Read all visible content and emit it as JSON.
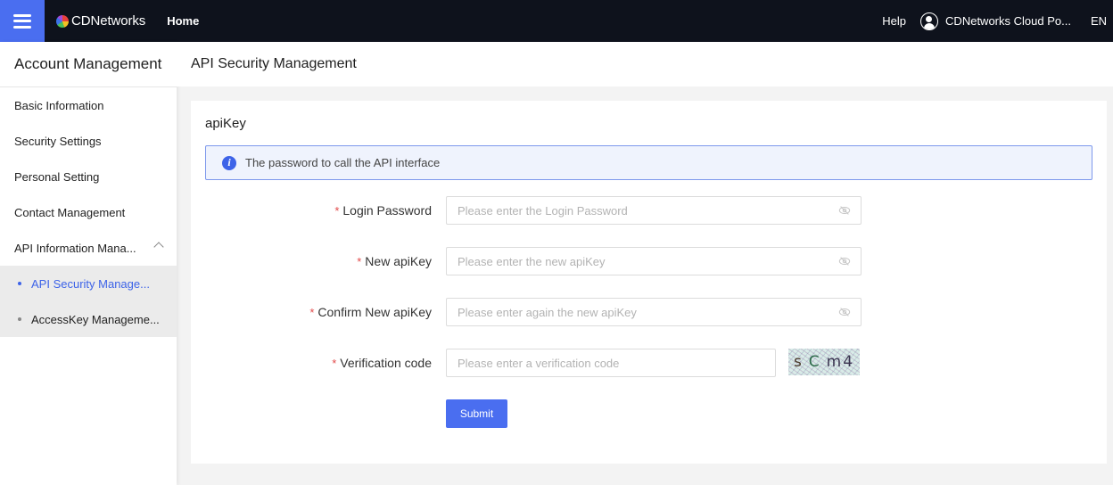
{
  "topbar": {
    "brand": "CDNetworks",
    "nav_home": "Home",
    "help": "Help",
    "user_name": "CDNetworks Cloud Po...",
    "language": "EN"
  },
  "sidebar": {
    "title": "Account Management",
    "items": [
      {
        "label": "Basic Information"
      },
      {
        "label": "Security Settings"
      },
      {
        "label": "Personal Setting"
      },
      {
        "label": "Contact Management"
      },
      {
        "label": "API Information Mana..."
      }
    ],
    "sub_items": [
      {
        "label": "API Security Manage...",
        "active": true
      },
      {
        "label": "AccessKey Manageme...",
        "active": false
      }
    ]
  },
  "page": {
    "title": "API Security Management"
  },
  "card": {
    "title": "apiKey",
    "alert": "The password to call the API interface",
    "fields": [
      {
        "label": "Login Password",
        "placeholder": "Please enter the Login Password",
        "value": ""
      },
      {
        "label": "New apiKey",
        "placeholder": "Please enter the new apiKey",
        "value": ""
      },
      {
        "label": "Confirm New apiKey",
        "placeholder": "Please enter again the new apiKey",
        "value": ""
      },
      {
        "label": "Verification code",
        "placeholder": "Please enter a verification code",
        "value": ""
      }
    ],
    "required_mark": "*",
    "captcha": {
      "chars": [
        "s",
        "C",
        "m4"
      ]
    },
    "submit_label": "Submit"
  },
  "colors": {
    "primary": "#4a6ef0",
    "topbar_bg": "#0e121c",
    "active_link": "#3d63e8",
    "required": "#e24a4a",
    "alert_bg": "#eff3fd",
    "alert_border": "#7d98ec"
  }
}
